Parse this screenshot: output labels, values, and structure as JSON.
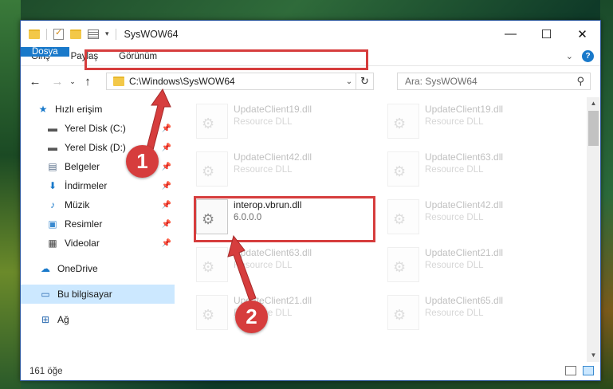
{
  "window": {
    "title": "SysWOW64"
  },
  "ribbon": {
    "tabs": [
      "Dosya",
      "Giriş",
      "Paylaş",
      "Görünüm"
    ],
    "help": "?"
  },
  "address": {
    "path": "C:\\Windows\\SysWOW64"
  },
  "search": {
    "placeholder": "Ara: SysWOW64"
  },
  "sidebar": {
    "items": [
      {
        "label": "Hızlı erişim",
        "icon": "star-icon"
      },
      {
        "label": "Yerel Disk (C:)",
        "icon": "drive-icon"
      },
      {
        "label": "Yerel Disk (D:)",
        "icon": "drive-icon"
      },
      {
        "label": "Belgeler",
        "icon": "documents-icon"
      },
      {
        "label": "İndirmeler",
        "icon": "download-icon"
      },
      {
        "label": "Müzik",
        "icon": "music-icon"
      },
      {
        "label": "Resimler",
        "icon": "pictures-icon"
      },
      {
        "label": "Videolar",
        "icon": "video-icon"
      },
      {
        "label": "OneDrive",
        "icon": "cloud-icon"
      },
      {
        "label": "Bu bilgisayar",
        "icon": "computer-icon"
      },
      {
        "label": "Ağ",
        "icon": "network-icon"
      }
    ]
  },
  "files": [
    {
      "name": "UpdateClient19.dll",
      "sub": "Resource DLL"
    },
    {
      "name": "UpdateClient19.dll",
      "sub": "Resource DLL"
    },
    {
      "name": "UpdateClient42.dll",
      "sub": "Resource DLL"
    },
    {
      "name": "UpdateClient63.dll",
      "sub": "Resource DLL"
    },
    {
      "name": "interop.vbrun.dll",
      "sub": "6.0.0.0"
    },
    {
      "name": "UpdateClient42.dll",
      "sub": "Resource DLL"
    },
    {
      "name": "UpdateClient63.dll",
      "sub": "Resource DLL"
    },
    {
      "name": "UpdateClient21.dll",
      "sub": "Resource DLL"
    },
    {
      "name": "UpdateClient21.dll",
      "sub": "Resource DLL"
    },
    {
      "name": "UpdateClient65.dll",
      "sub": "Resource DLL"
    }
  ],
  "status": {
    "count": "161 öğe"
  },
  "annotations": {
    "badge1": "1",
    "badge2": "2"
  },
  "colors": {
    "accent": "#1979ca",
    "highlight": "#d63d3d",
    "selected": "#cce8ff"
  }
}
